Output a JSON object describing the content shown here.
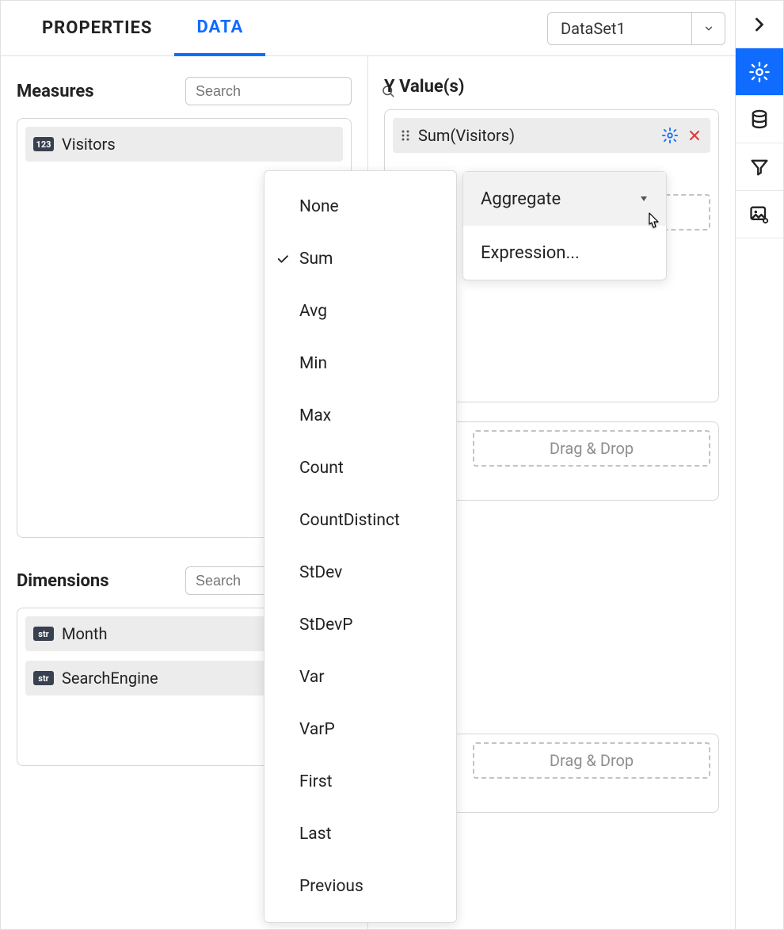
{
  "tabs": {
    "properties": "PROPERTIES",
    "data": "DATA"
  },
  "dataset": {
    "selected": "DataSet1"
  },
  "measures": {
    "title": "Measures",
    "search_placeholder": "Search",
    "items": [
      {
        "badge": "123",
        "label": "Visitors"
      }
    ]
  },
  "dimensions": {
    "title": "Dimensions",
    "search_placeholder": "Search",
    "items": [
      {
        "badge": "str",
        "label": "Month"
      },
      {
        "badge": "str",
        "label": "SearchEngine"
      }
    ]
  },
  "yvalues": {
    "title": "Y Value(s)",
    "items": [
      {
        "label": "Sum(Visitors)"
      }
    ],
    "dropzone_label": "Drag & Drop"
  },
  "row_dropzone_label": "Drag & Drop",
  "settings_menu": {
    "items": [
      {
        "label": "Aggregate",
        "has_submenu": true
      },
      {
        "label": "Expression...",
        "has_submenu": false
      }
    ]
  },
  "aggregate_menu": {
    "selected": "Sum",
    "items": [
      "None",
      "Sum",
      "Avg",
      "Min",
      "Max",
      "Count",
      "CountDistinct",
      "StDev",
      "StDevP",
      "Var",
      "VarP",
      "First",
      "Last",
      "Previous"
    ]
  },
  "colors": {
    "accent": "#0f6cff",
    "danger": "#e03636"
  }
}
